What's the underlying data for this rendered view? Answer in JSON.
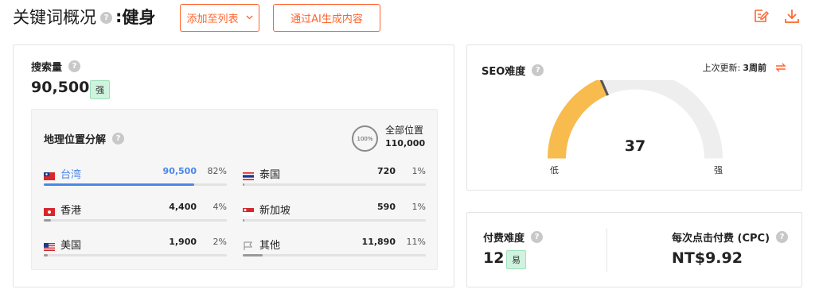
{
  "header": {
    "title_prefix": "关键词概况",
    "title_sep": ":",
    "keyword": "健身",
    "add_button": "添加至列表",
    "ai_button": "通过AI生成内容",
    "help_glyph": "?"
  },
  "volume": {
    "label": "搜索量",
    "value": "90,500",
    "badge": "强"
  },
  "geo": {
    "title": "地理位置分解",
    "total_circle": "100%",
    "total_label": "全部位置",
    "total_value": "110,000",
    "rows": [
      {
        "name": "台湾",
        "value": "90,500",
        "pct": "82%",
        "share": 0.82,
        "flag": "taiwan-flag-icon",
        "active": true
      },
      {
        "name": "香港",
        "value": "4,400",
        "pct": "4%",
        "share": 0.04,
        "flag": "hong-kong-flag-icon",
        "active": false
      },
      {
        "name": "美国",
        "value": "1,900",
        "pct": "2%",
        "share": 0.02,
        "flag": "us-flag-icon",
        "active": false
      },
      {
        "name": "泰国",
        "value": "720",
        "pct": "1%",
        "share": 0.01,
        "flag": "thailand-flag-icon",
        "active": false
      },
      {
        "name": "新加坡",
        "value": "590",
        "pct": "1%",
        "share": 0.01,
        "flag": "singapore-flag-icon",
        "active": false
      },
      {
        "name": "其他",
        "value": "11,890",
        "pct": "11%",
        "share": 0.11,
        "flag": "flag-outline-icon",
        "active": false
      }
    ]
  },
  "seo": {
    "label": "SEO难度",
    "update_label": "上次更新:",
    "update_value": "3周前",
    "value": "37",
    "score": 37,
    "low": "低",
    "high": "强"
  },
  "paid": {
    "label": "付费难度",
    "value": "12",
    "badge": "易"
  },
  "cpc": {
    "label": "每次点击付费 (CPC)",
    "value": "NT$9.92"
  },
  "colors": {
    "accent": "#ff642d",
    "active_blue": "#4a86e8",
    "gauge_fill": "#f8bb4e",
    "gauge_track": "#eeeeee",
    "badge_green": "#cff3de"
  }
}
